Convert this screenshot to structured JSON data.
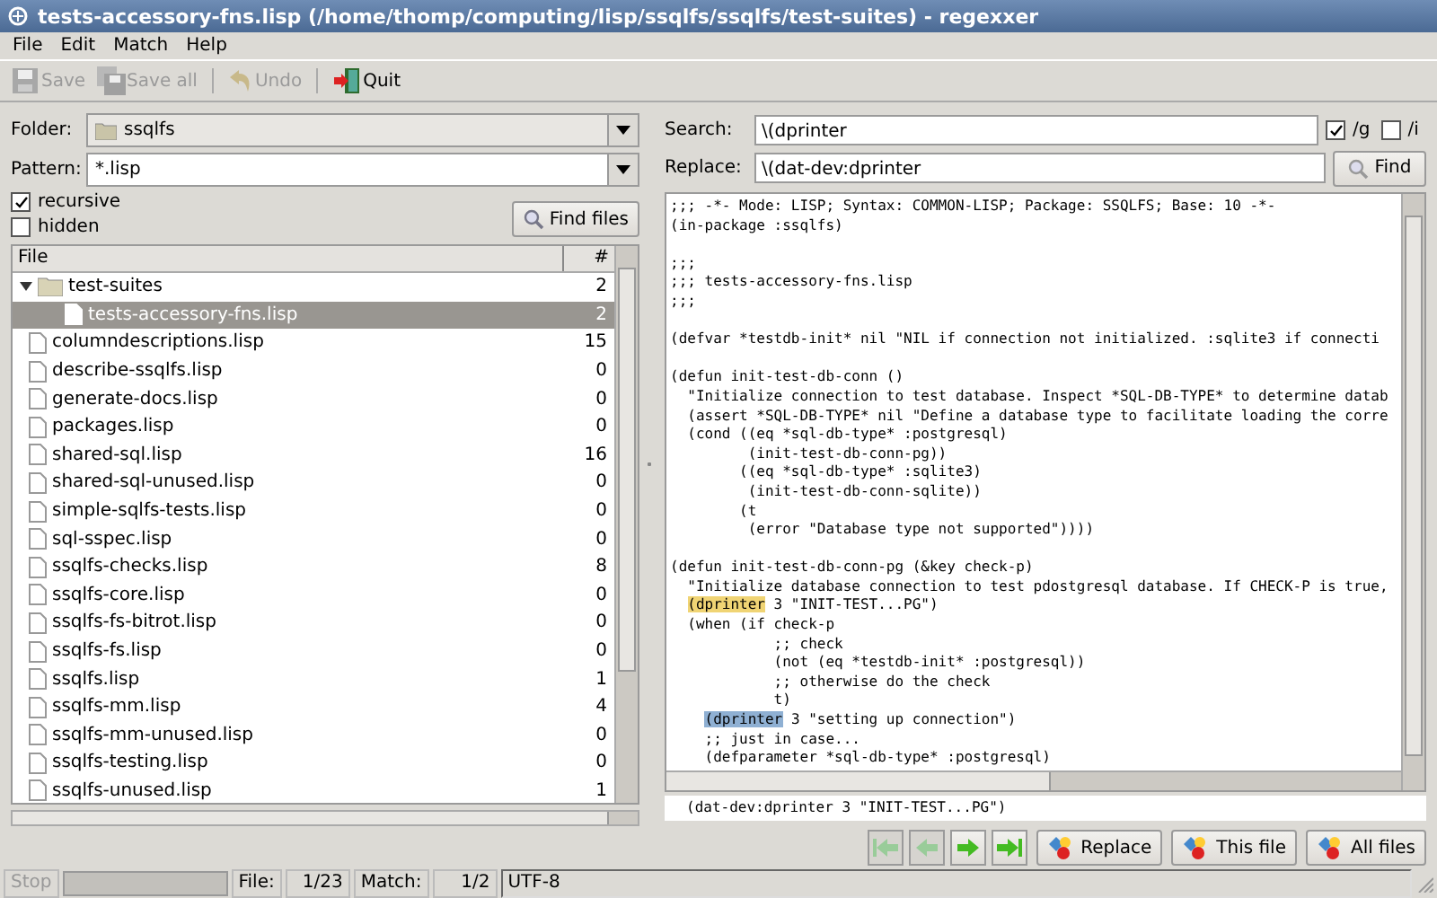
{
  "window": {
    "title": "tests-accessory-fns.lisp (/home/thomp/computing/lisp/ssqlfs/ssqlfs/test-suites) - regexxer"
  },
  "menu": [
    "File",
    "Edit",
    "Match",
    "Help"
  ],
  "toolbar": [
    {
      "label": "Save",
      "kind": "save",
      "disabled": true
    },
    {
      "label": "Save all",
      "kind": "save-all",
      "disabled": true
    },
    {
      "label": "Undo",
      "kind": "undo",
      "disabled": true
    },
    {
      "label": "Quit",
      "kind": "quit",
      "disabled": false
    }
  ],
  "folder": {
    "label": "Folder:",
    "value": "ssqlfs"
  },
  "pattern": {
    "label": "Pattern:",
    "value": "*.lisp"
  },
  "options": [
    {
      "label": "recursive",
      "checked": true
    },
    {
      "label": "hidden",
      "checked": false
    }
  ],
  "find_files_button": "Find files",
  "tree": {
    "columns": [
      "File",
      "#"
    ],
    "rows": [
      {
        "name": "test-suites",
        "count": "2",
        "kind": "folder",
        "expanded": true,
        "selected": false,
        "children": [
          {
            "name": "tests-accessory-fns.lisp",
            "count": "2",
            "kind": "file",
            "selected": true
          }
        ]
      },
      {
        "name": "columndescriptions.lisp",
        "count": "15",
        "kind": "file",
        "selected": false
      },
      {
        "name": "describe-ssqlfs.lisp",
        "count": "0",
        "kind": "file",
        "selected": false
      },
      {
        "name": "generate-docs.lisp",
        "count": "0",
        "kind": "file",
        "selected": false
      },
      {
        "name": "packages.lisp",
        "count": "0",
        "kind": "file",
        "selected": false
      },
      {
        "name": "shared-sql.lisp",
        "count": "16",
        "kind": "file",
        "selected": false
      },
      {
        "name": "shared-sql-unused.lisp",
        "count": "0",
        "kind": "file",
        "selected": false
      },
      {
        "name": "simple-sqlfs-tests.lisp",
        "count": "0",
        "kind": "file",
        "selected": false
      },
      {
        "name": "sql-sspec.lisp",
        "count": "0",
        "kind": "file",
        "selected": false
      },
      {
        "name": "ssqlfs-checks.lisp",
        "count": "8",
        "kind": "file",
        "selected": false
      },
      {
        "name": "ssqlfs-core.lisp",
        "count": "0",
        "kind": "file",
        "selected": false
      },
      {
        "name": "ssqlfs-fs-bitrot.lisp",
        "count": "0",
        "kind": "file",
        "selected": false
      },
      {
        "name": "ssqlfs-fs.lisp",
        "count": "0",
        "kind": "file",
        "selected": false
      },
      {
        "name": "ssqlfs.lisp",
        "count": "1",
        "kind": "file",
        "selected": false
      },
      {
        "name": "ssqlfs-mm.lisp",
        "count": "4",
        "kind": "file",
        "selected": false
      },
      {
        "name": "ssqlfs-mm-unused.lisp",
        "count": "0",
        "kind": "file",
        "selected": false
      },
      {
        "name": "ssqlfs-testing.lisp",
        "count": "0",
        "kind": "file",
        "selected": false
      },
      {
        "name": "ssqlfs-unused.lisp",
        "count": "1",
        "kind": "file",
        "selected": false
      }
    ]
  },
  "search": {
    "label": "Search:",
    "value": "\\(dprinter"
  },
  "replace": {
    "label": "Replace:",
    "value": "\\(dat-dev:dprinter"
  },
  "flags": [
    {
      "label": "/g",
      "checked": true
    },
    {
      "label": "/i",
      "checked": false
    }
  ],
  "find_button": "Find",
  "code": [
    {
      "kind": "text",
      "text": ";;; -*- Mode: LISP; Syntax: COMMON-LISP; Package: SSQLFS; Base: 10 -*-"
    },
    {
      "kind": "text",
      "text": "(in-package :ssqlfs)"
    },
    {
      "kind": "blank"
    },
    {
      "kind": "text",
      "text": ";;;"
    },
    {
      "kind": "text",
      "text": ";;; tests-accessory-fns.lisp"
    },
    {
      "kind": "text",
      "text": ";;;"
    },
    {
      "kind": "blank"
    },
    {
      "kind": "text",
      "text": "(defvar *testdb-init* nil \"NIL if connection not initialized. :sqlite3 if connecti"
    },
    {
      "kind": "blank"
    },
    {
      "kind": "text",
      "text": "(defun init-test-db-conn ()"
    },
    {
      "kind": "text",
      "text": "  \"Initialize connection to test database. Inspect *SQL-DB-TYPE* to determine datab"
    },
    {
      "kind": "text",
      "text": "  (assert *SQL-DB-TYPE* nil \"Define a database type to facilitate loading the corre"
    },
    {
      "kind": "text",
      "text": "  (cond ((eq *sql-db-type* :postgresql)"
    },
    {
      "kind": "text",
      "text": "         (init-test-db-conn-pg))"
    },
    {
      "kind": "text",
      "text": "        ((eq *sql-db-type* :sqlite3)"
    },
    {
      "kind": "text",
      "text": "         (init-test-db-conn-sqlite))"
    },
    {
      "kind": "text",
      "text": "        (t"
    },
    {
      "kind": "text",
      "text": "         (error \"Database type not supported\"))))"
    },
    {
      "kind": "blank"
    },
    {
      "kind": "text",
      "text": "(defun init-test-db-conn-pg (&key check-p)"
    },
    {
      "kind": "text",
      "text": "  \"Initialize database connection to test pdostgresql database. If CHECK-P is true,"
    },
    {
      "kind": "match",
      "match": "(dprinter",
      "post": " 3 \"INIT-TEST...PG\")",
      "current": false
    },
    {
      "kind": "text",
      "text": "  (when (if check-p"
    },
    {
      "kind": "text",
      "text": "            ;; check"
    },
    {
      "kind": "text",
      "text": "            (not (eq *testdb-init* :postgresql))"
    },
    {
      "kind": "text",
      "text": "            ;; otherwise do the check"
    },
    {
      "kind": "text",
      "text": "            t)"
    },
    {
      "kind": "match",
      "match": "(dprinter",
      "post": " 3 \"setting up connection\")",
      "current": true
    },
    {
      "kind": "text",
      "text": "    ;; just in case..."
    },
    {
      "kind": "text",
      "text": "    (defparameter *sql-db-type* :postgresql)"
    }
  ],
  "preview": "(dat-dev:dprinter 3 \"INIT-TEST...PG\")",
  "nav_buttons": [
    {
      "kind": "first",
      "disabled": true
    },
    {
      "kind": "prev",
      "disabled": true
    },
    {
      "kind": "next",
      "disabled": false
    },
    {
      "kind": "last",
      "disabled": false
    }
  ],
  "action_buttons": [
    "Replace",
    "This file",
    "All files"
  ],
  "status_bar": {
    "stop": "Stop",
    "progress": {
      "level": 0
    },
    "file_label": "File:",
    "file_value": "1/23",
    "match_label": "Match:",
    "match_value": "1/2",
    "encoding": "UTF-8"
  }
}
